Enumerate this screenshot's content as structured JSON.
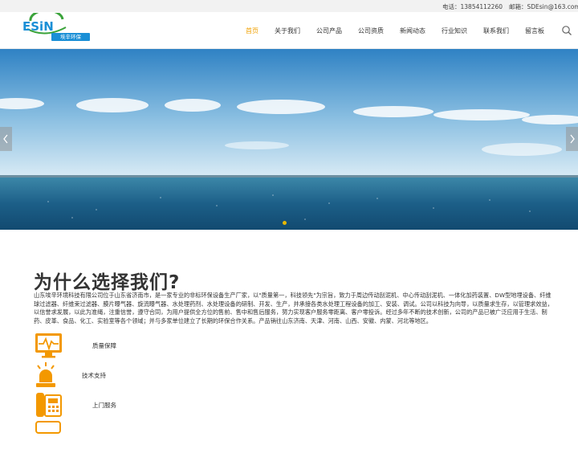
{
  "topbar": {
    "phone": "电话：13854112260",
    "email": "邮箱：SDEsin@163.com"
  },
  "logo": {
    "brand": "ESiN",
    "sub": "埃辛环保"
  },
  "nav": {
    "items": [
      {
        "label": "首页",
        "active": true
      },
      {
        "label": "关于我们",
        "active": false
      },
      {
        "label": "公司产品",
        "active": false
      },
      {
        "label": "公司资质",
        "active": false
      },
      {
        "label": "新闻动态",
        "active": false
      },
      {
        "label": "行业知识",
        "active": false
      },
      {
        "label": "联系我们",
        "active": false
      },
      {
        "label": "留言板",
        "active": false
      }
    ],
    "search_icon": "search-icon"
  },
  "banner": {
    "arrow_left": "chevron-left-icon",
    "arrow_right": "chevron-right-icon"
  },
  "why": {
    "title": "为什么选择我们?",
    "intro": "山东埃辛环境科技有限公司位于山东省济南市，是一家专业的非标环保设备生产厂家，以\"质量第一，科技领先\"为宗旨，致力于周边传动刮泥机、中心传动刮泥机、一体化加药装置、DW型地埋设备、纤维球过滤器、纤维束过滤器、膜片曝气器、旋流曝气器、水处理药剂、水处理设备的研制、开发、生产，并承接各类水处理工程设备的加工、安装、调试。公司以科技为向导，以质量求生存，以管理求效益，以信誉求发展，以此为准绳，注重信誉，遵守合同，为用户提供全方位的售前、售中和售后服务，努力实现客户服务零距离、客户零投诉。经过多年不断的技术创新，公司的产品已被广泛应用于生活、制药、皮革、食品、化工、实验室等各个领域；并与多家单位建立了长期的环保合作关系。产品销往山东济南、天津、河南、山西、安徽、内蒙、河北等地区。",
    "features": [
      {
        "label": "质量保障",
        "icon": "monitor-icon"
      },
      {
        "label": "技术支持",
        "icon": "alarm-light-icon"
      },
      {
        "label": "上门服务",
        "icon": "phone-icon"
      }
    ]
  },
  "colors": {
    "accent": "#f0a000",
    "brand_blue": "#1a8fd6",
    "brand_green": "#3aa33a"
  }
}
